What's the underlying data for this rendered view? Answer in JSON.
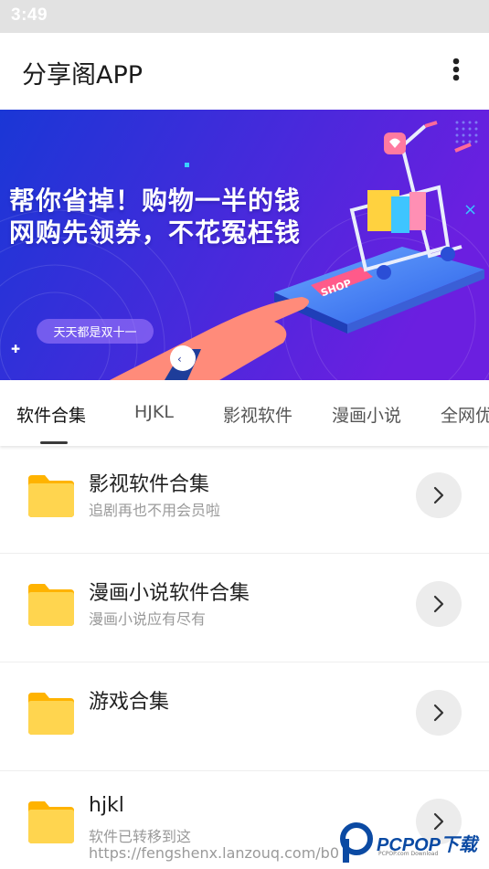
{
  "status_bar": {
    "time": "3:49"
  },
  "app_bar": {
    "title": "分享阁APP",
    "more_icon": "more-vert-icon"
  },
  "banner": {
    "line1": "帮你省掉！购物一半的钱",
    "line2": "网购先领券，不花冤枉钱",
    "tag": "天天都是双十一",
    "shop_label": "SHOP",
    "colors": {
      "gradient_start": "#1a37d6",
      "gradient_end": "#6b1fe0"
    }
  },
  "tabs": [
    {
      "label": "软件合集",
      "active": true
    },
    {
      "label": "HJKL",
      "active": false
    },
    {
      "label": "影视软件",
      "active": false
    },
    {
      "label": "漫画小说",
      "active": false
    },
    {
      "label": "全网优",
      "active": false
    }
  ],
  "list": [
    {
      "title": "影视软件合集",
      "subtitle": "追剧再也不用会员啦",
      "icon": "folder-icon"
    },
    {
      "title": "漫画小说软件合集",
      "subtitle": "漫画小说应有尽有",
      "icon": "folder-icon"
    },
    {
      "title": "游戏合集",
      "subtitle": "",
      "icon": "folder-icon"
    },
    {
      "title": "hjkl",
      "subtitle": "软件已转移到这",
      "icon": "folder-icon"
    }
  ],
  "watermark": {
    "url": "https://fengshenx.lanzouq.com/b0",
    "brand": "PCPOP下载",
    "brand_sub": "PCPOP.com Download"
  },
  "colors": {
    "folder": "#ffd54f",
    "folder_tab": "#ffb300",
    "accent": "#0b4aa3"
  }
}
